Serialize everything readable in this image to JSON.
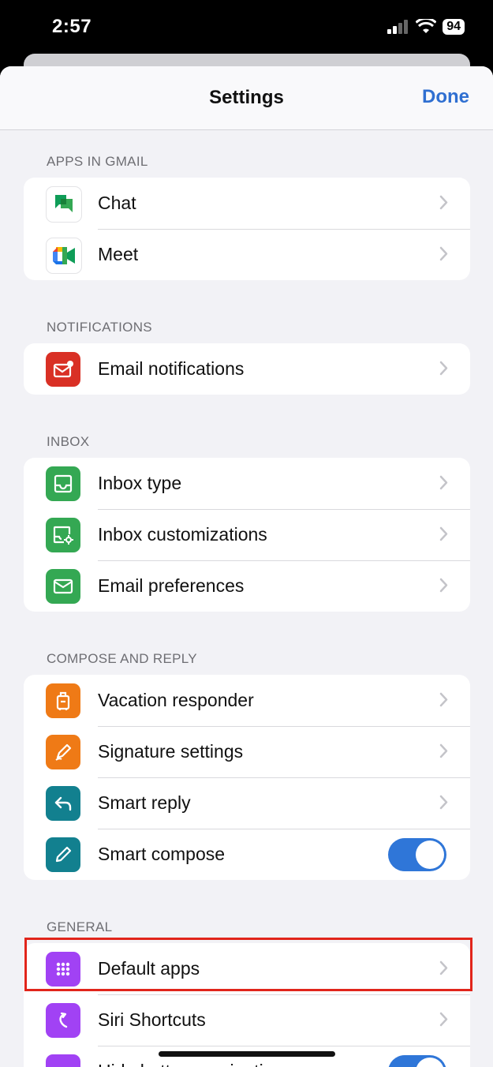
{
  "status_bar": {
    "time": "2:57",
    "battery": "94"
  },
  "header": {
    "title": "Settings",
    "done_label": "Done"
  },
  "sections": {
    "apps": {
      "title": "APPS IN GMAIL",
      "items": [
        "Chat",
        "Meet"
      ]
    },
    "notifications": {
      "title": "NOTIFICATIONS",
      "items": [
        "Email notifications"
      ]
    },
    "inbox": {
      "title": "INBOX",
      "items": [
        "Inbox type",
        "Inbox customizations",
        "Email preferences"
      ]
    },
    "compose": {
      "title": "COMPOSE AND REPLY",
      "items": [
        "Vacation responder",
        "Signature settings",
        "Smart reply",
        "Smart compose"
      ]
    },
    "general": {
      "title": "GENERAL",
      "items": [
        "Default apps",
        "Siri Shortcuts",
        "Hide bottom navigation"
      ]
    }
  },
  "toggles": {
    "smart_compose": true,
    "hide_bottom_navigation": true
  },
  "colors": {
    "accent": "#2f6fd1",
    "highlight": "#e1251b",
    "green": "#34a853",
    "orange": "#ef7a16",
    "teal": "#12808f",
    "purple": "#a142f4",
    "red": "#d93025"
  }
}
